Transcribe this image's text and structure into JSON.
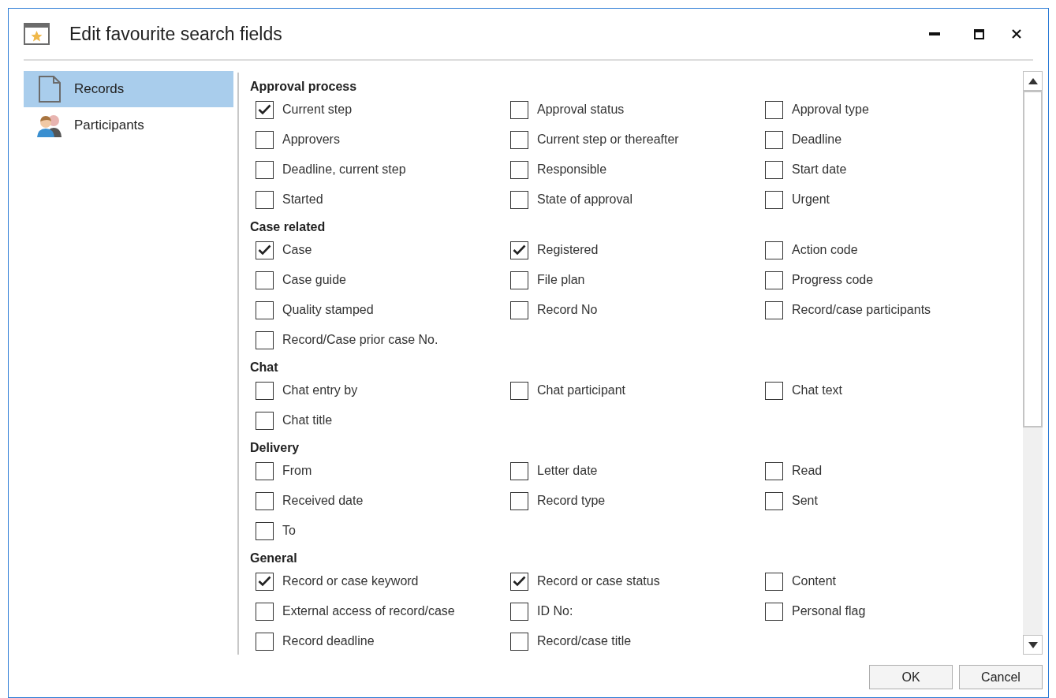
{
  "window": {
    "title": "Edit favourite search fields"
  },
  "sidebar": {
    "items": [
      {
        "label": "Records",
        "kind": "document",
        "selected": true
      },
      {
        "label": "Participants",
        "kind": "people",
        "selected": false
      }
    ]
  },
  "sections": [
    {
      "title": "Approval process",
      "fields": [
        {
          "label": "Current step",
          "checked": true
        },
        {
          "label": "Approval status",
          "checked": false
        },
        {
          "label": "Approval type",
          "checked": false
        },
        {
          "label": "Approvers",
          "checked": false
        },
        {
          "label": "Current step or thereafter",
          "checked": false
        },
        {
          "label": "Deadline",
          "checked": false
        },
        {
          "label": "Deadline, current step",
          "checked": false
        },
        {
          "label": "Responsible",
          "checked": false
        },
        {
          "label": "Start date",
          "checked": false
        },
        {
          "label": "Started",
          "checked": false
        },
        {
          "label": "State of approval",
          "checked": false
        },
        {
          "label": "Urgent",
          "checked": false
        }
      ]
    },
    {
      "title": "Case related",
      "fields": [
        {
          "label": "Case",
          "checked": true
        },
        {
          "label": "Registered",
          "checked": true
        },
        {
          "label": "Action code",
          "checked": false
        },
        {
          "label": "Case guide",
          "checked": false
        },
        {
          "label": "File plan",
          "checked": false
        },
        {
          "label": "Progress code",
          "checked": false
        },
        {
          "label": "Quality stamped",
          "checked": false
        },
        {
          "label": "Record No",
          "checked": false
        },
        {
          "label": "Record/case participants",
          "checked": false
        },
        {
          "label": "Record/Case prior case No.",
          "checked": false
        }
      ]
    },
    {
      "title": "Chat",
      "fields": [
        {
          "label": "Chat entry by",
          "checked": false
        },
        {
          "label": "Chat participant",
          "checked": false
        },
        {
          "label": "Chat text",
          "checked": false
        },
        {
          "label": "Chat title",
          "checked": false
        }
      ]
    },
    {
      "title": "Delivery",
      "fields": [
        {
          "label": "From",
          "checked": false
        },
        {
          "label": "Letter date",
          "checked": false
        },
        {
          "label": "Read",
          "checked": false
        },
        {
          "label": "Received date",
          "checked": false
        },
        {
          "label": "Record type",
          "checked": false
        },
        {
          "label": "Sent",
          "checked": false
        },
        {
          "label": "To",
          "checked": false
        }
      ]
    },
    {
      "title": "General",
      "fields": [
        {
          "label": "Record or case keyword",
          "checked": true
        },
        {
          "label": "Record or case status",
          "checked": true
        },
        {
          "label": "Content",
          "checked": false
        },
        {
          "label": "External access of record/case",
          "checked": false
        },
        {
          "label": "ID No:",
          "checked": false
        },
        {
          "label": "Personal flag",
          "checked": false
        },
        {
          "label": "Record deadline",
          "checked": false
        },
        {
          "label": "Record/case title",
          "checked": false
        }
      ]
    }
  ],
  "buttons": [
    {
      "label": "OK"
    },
    {
      "label": "Cancel"
    }
  ]
}
